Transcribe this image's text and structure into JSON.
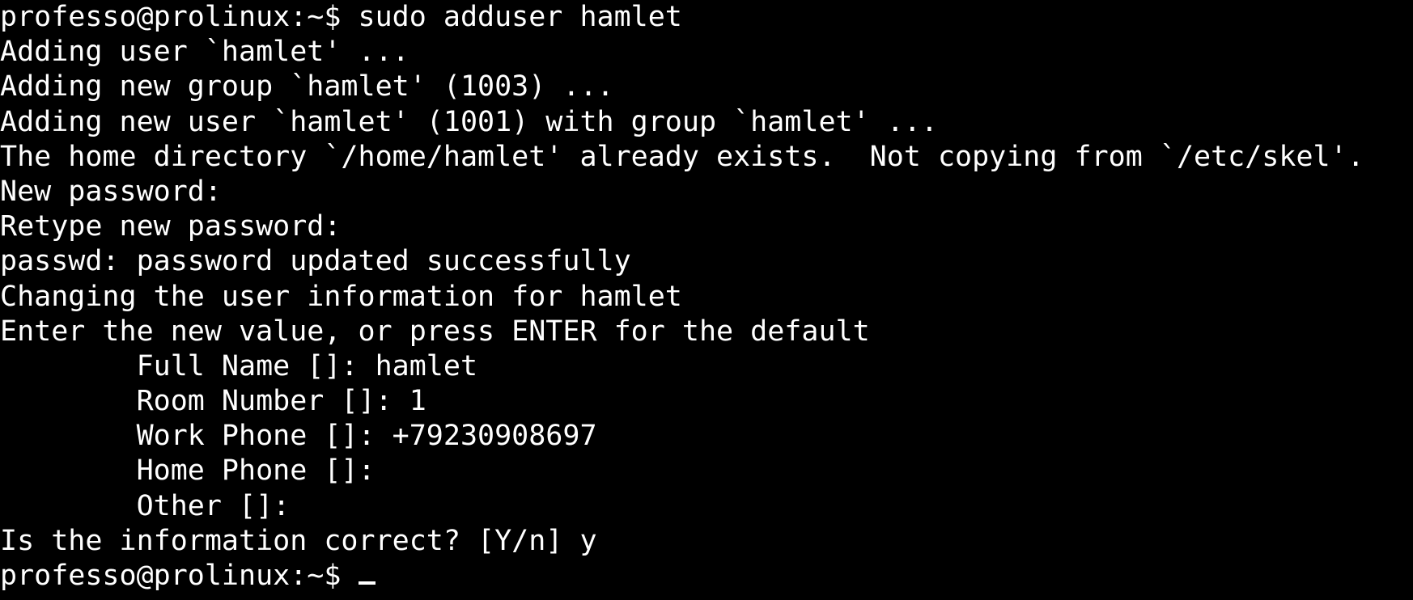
{
  "terminal": {
    "lines": [
      "professo@prolinux:~$ sudo adduser hamlet",
      "Adding user `hamlet' ...",
      "Adding new group `hamlet' (1003) ...",
      "Adding new user `hamlet' (1001) with group `hamlet' ...",
      "The home directory `/home/hamlet' already exists.  Not copying from `/etc/skel'.",
      "New password:",
      "Retype new password:",
      "passwd: password updated successfully",
      "Changing the user information for hamlet",
      "Enter the new value, or press ENTER for the default",
      "        Full Name []: hamlet",
      "        Room Number []: 1",
      "        Work Phone []: +79230908697",
      "        Home Phone []:",
      "        Other []:",
      "Is the information correct? [Y/n] y"
    ],
    "prompt": "professo@prolinux:~$ "
  },
  "colors": {
    "background": "#000000",
    "foreground": "#ffffff"
  }
}
